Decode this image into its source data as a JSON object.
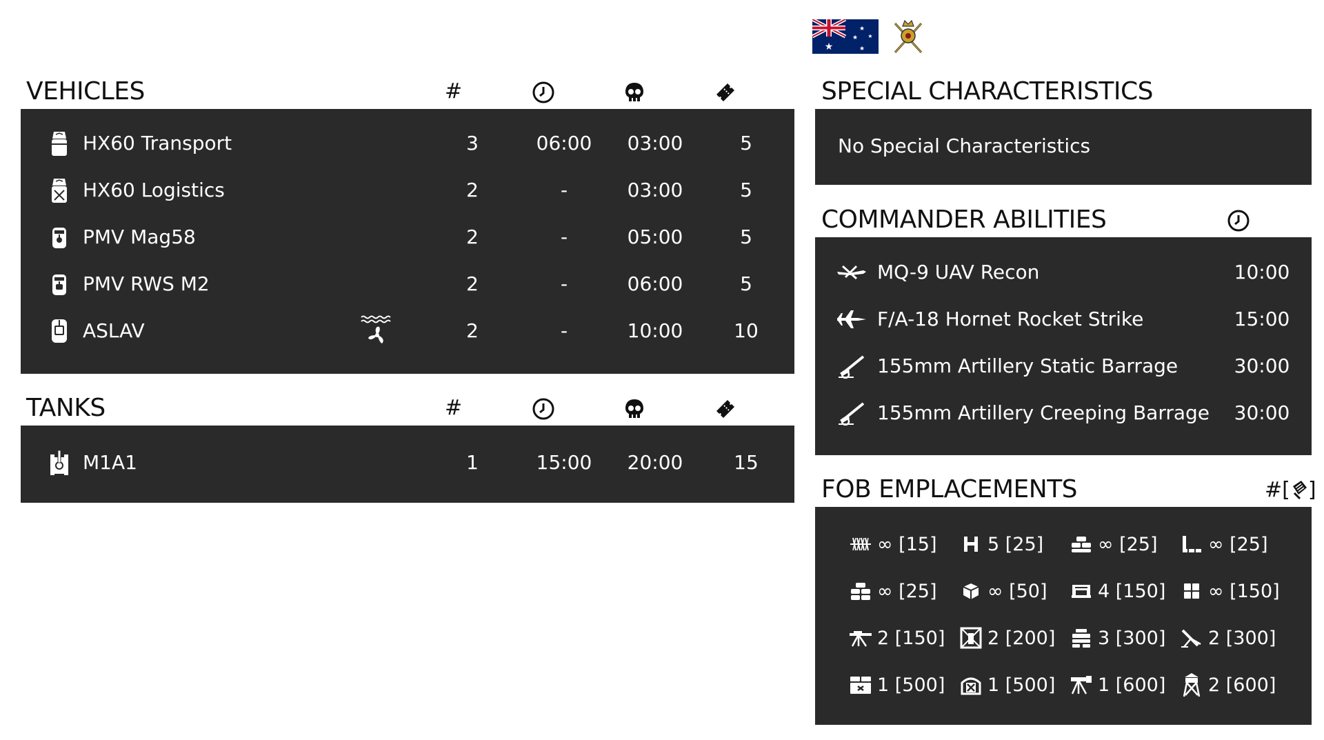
{
  "faction": {
    "flag": "australia-flag",
    "emblem": "crossed-swords-crown-emblem"
  },
  "vehicles": {
    "title": "VEHICLES",
    "col_count": "#",
    "col_time_icon": "clock-icon",
    "col_respawn_icon": "skull-icon",
    "col_ticket_icon": "ticket-icon",
    "rows": [
      {
        "icon": "truck-transport-icon",
        "name": "HX60 Transport",
        "count": "3",
        "delay": "06:00",
        "respawn": "03:00",
        "tickets": "5"
      },
      {
        "icon": "truck-logistics-icon",
        "name": "HX60 Logistics",
        "count": "2",
        "delay": "-",
        "respawn": "03:00",
        "tickets": "5"
      },
      {
        "icon": "mrap-icon",
        "name": "PMV Mag58",
        "count": "2",
        "delay": "-",
        "respawn": "05:00",
        "tickets": "5"
      },
      {
        "icon": "mrap-rws-icon",
        "name": "PMV RWS M2",
        "count": "2",
        "delay": "-",
        "respawn": "06:00",
        "tickets": "5"
      },
      {
        "icon": "ifv-icon",
        "name": "ASLAV",
        "amphibious": "amphibious-propeller-icon",
        "count": "2",
        "delay": "-",
        "respawn": "10:00",
        "tickets": "10"
      }
    ]
  },
  "tanks": {
    "title": "TANKS",
    "col_count": "#",
    "rows": [
      {
        "icon": "tank-icon",
        "name": "M1A1",
        "count": "1",
        "delay": "15:00",
        "respawn": "20:00",
        "tickets": "15"
      }
    ]
  },
  "special": {
    "title": "SPECIAL CHARACTERISTICS",
    "text": "No Special Characteristics"
  },
  "commander": {
    "title": "COMMANDER ABILITIES",
    "col_icon": "clock-icon",
    "rows": [
      {
        "icon": "uav-icon",
        "name": "MQ-9 UAV Recon",
        "cooldown": "10:00"
      },
      {
        "icon": "jet-icon",
        "name": "F/A-18 Hornet Rocket Strike",
        "cooldown": "15:00"
      },
      {
        "icon": "artillery-icon",
        "name": "155mm Artillery Static Barrage",
        "cooldown": "30:00"
      },
      {
        "icon": "artillery-icon",
        "name": "155mm Artillery Creeping Barrage",
        "cooldown": "30:00"
      }
    ]
  },
  "fob": {
    "title": "FOB EMPLACEMENTS",
    "header_hash": "#[",
    "header_close": "]",
    "header_icon": "construction-ammo-icon",
    "items": [
      {
        "icon": "razorwire-icon",
        "label": "∞ [15]"
      },
      {
        "icon": "hesco-icon",
        "label": "5 [25]"
      },
      {
        "icon": "sandbag-icon",
        "label": "∞ [25]"
      },
      {
        "icon": "sandbag-wall-icon",
        "label": "∞ [25]"
      },
      {
        "icon": "sandbags-icon",
        "label": "∞ [25]"
      },
      {
        "icon": "crate-icon",
        "label": "∞ [50]"
      },
      {
        "icon": "bunker-icon",
        "label": "4 [150]"
      },
      {
        "icon": "hesco-grid-icon",
        "label": "∞ [150]"
      },
      {
        "icon": "machinegun-icon",
        "label": "2 [150]"
      },
      {
        "icon": "tower-frame-icon",
        "label": "2 [200]"
      },
      {
        "icon": "sandbag-bunker-icon",
        "label": "3 [300]"
      },
      {
        "icon": "mortar-icon",
        "label": "2 [300]"
      },
      {
        "icon": "ammo-cache-icon",
        "label": "1 [500]"
      },
      {
        "icon": "repair-station-icon",
        "label": "1 [500]"
      },
      {
        "icon": "heavy-mg-icon",
        "label": "1 [600]"
      },
      {
        "icon": "watchtower-icon",
        "label": "2 [600]"
      }
    ]
  }
}
